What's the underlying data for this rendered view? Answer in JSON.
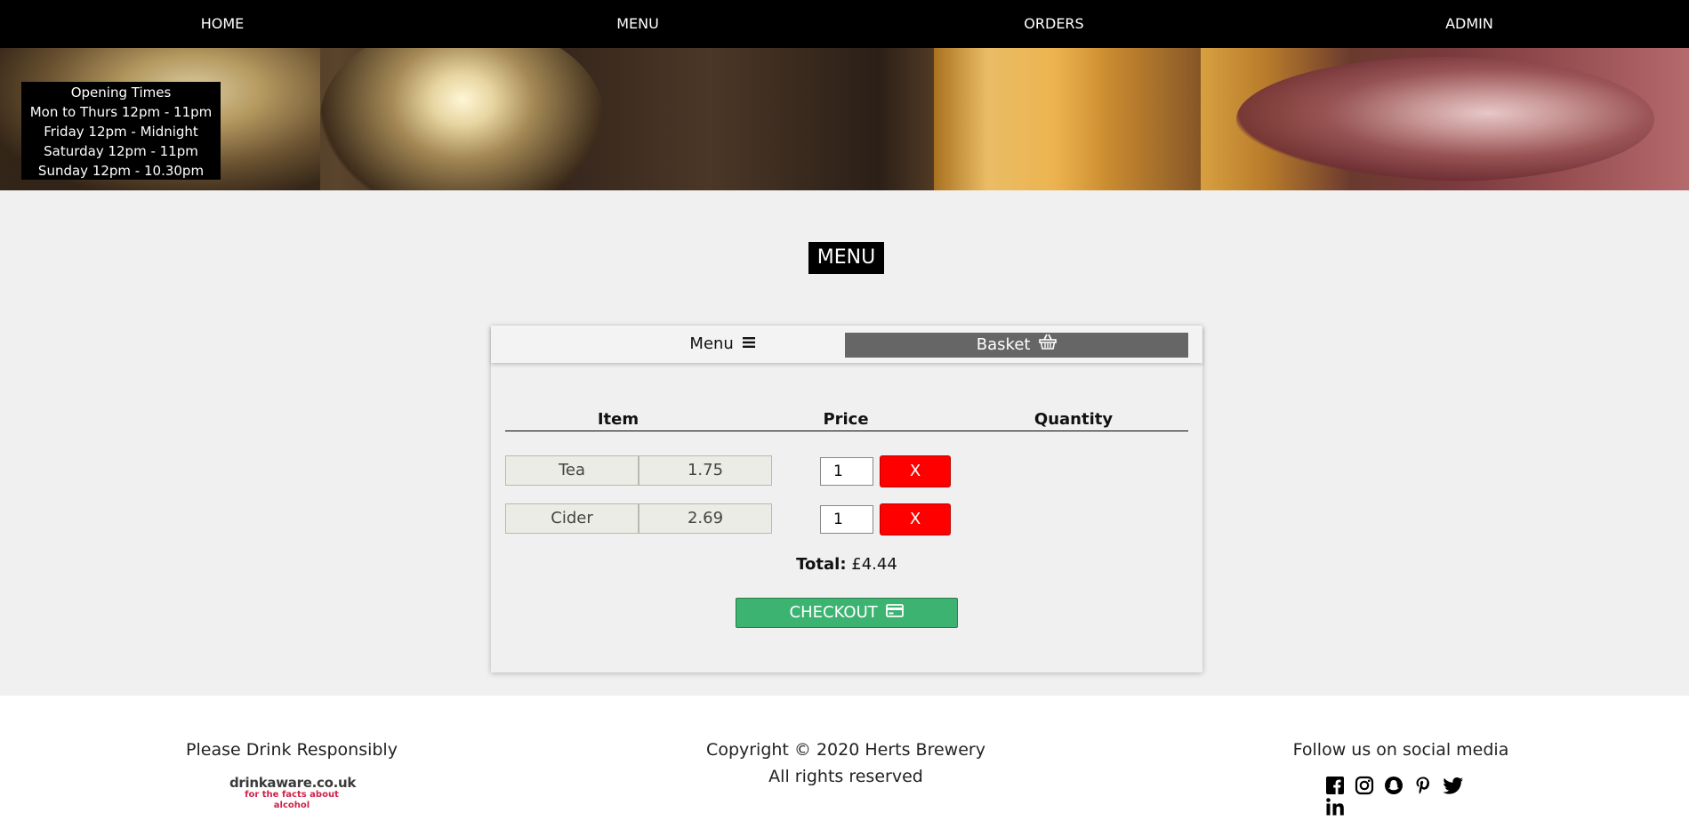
{
  "nav": {
    "items": [
      {
        "label": "HOME"
      },
      {
        "label": "MENU"
      },
      {
        "label": "ORDERS"
      },
      {
        "label": "ADMIN"
      }
    ]
  },
  "hours": {
    "title": "Opening Times",
    "lines": [
      "Mon to Thurs 12pm - 11pm",
      "Friday 12pm - Midnight",
      "Saturday 12pm - 11pm",
      "Sunday 12pm - 10.30pm"
    ]
  },
  "page": {
    "title": "MENU"
  },
  "tabs": {
    "menu_label": "Menu",
    "basket_label": "Basket",
    "menu_icon": "hamburger-icon",
    "basket_icon": "basket-icon"
  },
  "table": {
    "headers": [
      "Item",
      "Price",
      "Quantity"
    ],
    "rows": [
      {
        "name": "Tea",
        "price": "1.75",
        "quantity": "1",
        "remove_label": "X"
      },
      {
        "name": "Cider",
        "price": "2.69",
        "quantity": "1",
        "remove_label": "X"
      }
    ]
  },
  "total": {
    "label": "Total:",
    "value": "£4.44"
  },
  "checkout": {
    "label": "CHECKOUT",
    "icon": "credit-card-icon"
  },
  "footer": {
    "left": "Please Drink Responsibly",
    "logo_main": "drinkaware.co.uk",
    "logo_sub": "for the facts about alcohol",
    "copyright": "Copyright © 2020 Herts Brewery",
    "rights": "All rights reserved",
    "social_heading": "Follow us on social media",
    "social_icons": [
      "facebook-icon",
      "instagram-icon",
      "snapchat-icon",
      "pinterest-icon",
      "twitter-icon",
      "linkedin-icon"
    ]
  },
  "colors": {
    "nav_bg": "#000000",
    "basket_tab": "#666666",
    "remove": "#ff0000",
    "checkout": "#3cb371",
    "logo_accent": "#d0204a"
  }
}
